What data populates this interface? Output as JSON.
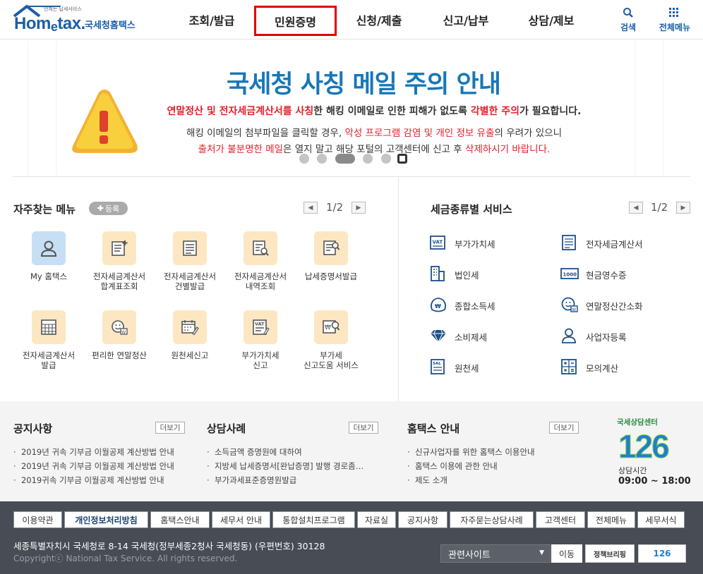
{
  "header": {
    "logo_small": "언제든 납세서비스",
    "logo_main": "Hom",
    "logo_e": "e",
    "logo_tax": "tax.",
    "logo_ko": "국세청홈택스",
    "nav": [
      {
        "label": "조회/발급"
      },
      {
        "label": "민원증명"
      },
      {
        "label": "신청/제출"
      },
      {
        "label": "신고/납부"
      },
      {
        "label": "상담/제보"
      }
    ],
    "search_label": "검색",
    "allmenu_label": "전체메뉴"
  },
  "banner": {
    "title": "국세청 사칭 메일 주의 안내",
    "line1_a": "연말정산 및 전자세금계산서를 사칭",
    "line1_b": "한 해킹 이메일로 인한 피해가 없도록 ",
    "line1_c": "각별한 주의",
    "line1_d": "가 필요합니다.",
    "line2_a": "해킹 이메일의 첨부파일을 클릭할 경우, ",
    "line2_b": "악성 프로그램 감염 및 개인 정보 유출",
    "line2_c": "의 우려가 있으니",
    "line3_a": "출처가 불분명한 메일",
    "line3_b": "은 열지 말고 해당 포털의 고객센터에 신고 후 ",
    "line3_c": "삭제하시기 바랍니다."
  },
  "favorites": {
    "title": "자주찾는 메뉴",
    "register_label": "등록",
    "pager": "1/2",
    "items": [
      {
        "l1": "My 홈택스",
        "l2": ""
      },
      {
        "l1": "전자세금계산서",
        "l2": "합계표조회"
      },
      {
        "l1": "전자세금계산서",
        "l2": "건별발급"
      },
      {
        "l1": "전자세금계산서",
        "l2": "내역조회"
      },
      {
        "l1": "납세증명서발급",
        "l2": ""
      },
      {
        "l1": "전자세금계산서",
        "l2": "발급"
      },
      {
        "l1": "편리한 연말정산",
        "l2": ""
      },
      {
        "l1": "원천세신고",
        "l2": ""
      },
      {
        "l1": "부가가치세",
        "l2": "신고"
      },
      {
        "l1": "부가세",
        "l2": "신고도움 서비스"
      }
    ]
  },
  "taxservice": {
    "title": "세금종류별 서비스",
    "pager": "1/2",
    "items": [
      {
        "label": "부가가치세",
        "icon": "vat-icon"
      },
      {
        "label": "전자세금계산서",
        "icon": "invoice-icon"
      },
      {
        "label": "법인세",
        "icon": "building-icon"
      },
      {
        "label": "현금영수증",
        "icon": "cash-receipt-icon"
      },
      {
        "label": "종합소득세",
        "icon": "money-bag-icon"
      },
      {
        "label": "연말정산간소화",
        "icon": "yearend-icon"
      },
      {
        "label": "소비제세",
        "icon": "diamond-icon"
      },
      {
        "label": "사업자등록",
        "icon": "person-icon"
      },
      {
        "label": "원천세",
        "icon": "salary-icon"
      },
      {
        "label": "모의계산",
        "icon": "calculator-icon"
      }
    ]
  },
  "notice": {
    "more_label": "더보기",
    "cols": [
      {
        "title": "공지사항",
        "items": [
          "2019년 귀속 기부금 이월공제 계산방법 안내",
          "2019년 귀속 기부금 이월공제 계산방법 안내",
          "2019귀속 기부금 이월공제 계산방법 안내"
        ]
      },
      {
        "title": "상담사례",
        "items": [
          "소득금액 증명원에 대하여",
          "지방세 납세증명서[완납증명] 발행 경로좀…",
          "부가과세표준증명원발급"
        ]
      },
      {
        "title": "홈택스 안내",
        "items": [
          "신규사업자를 위한 홈택스 이용안내",
          "홈택스 이용에 관한 안내",
          "제도 소개"
        ]
      }
    ],
    "center_title": "국세상담센터",
    "center_number": "126",
    "center_hours_label": "상담시간",
    "center_hours": "09:00 ~ 18:00"
  },
  "footer": {
    "links": [
      "이용약관",
      "개인정보처리방침",
      "홈택스안내",
      "세무서 안내",
      "통합설치프로그램",
      "자료실",
      "공지사항",
      "자주묻는상담사례",
      "고객센터",
      "전체메뉴",
      "세무서식"
    ],
    "address": "세종특별자치시 국세청로 8-14 국세청(정부세종2청사 국세청동) (우편번호) 30128",
    "copyright": "Copyrightⓒ National Tax Service. All rights reserved.",
    "related_label": "관련사이트",
    "go_label": "이동",
    "banner1": "정책브리핑",
    "banner2": "126"
  }
}
